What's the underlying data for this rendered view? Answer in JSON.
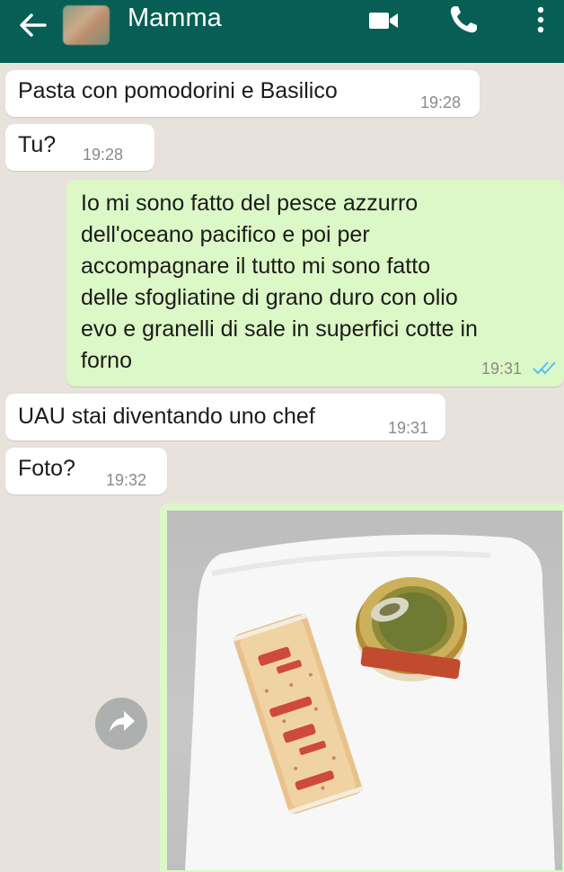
{
  "header": {
    "contact_name": "Mamma",
    "icons": [
      "back-arrow-icon",
      "avatar",
      "video-call-icon",
      "phone-icon",
      "more-options-icon"
    ],
    "bg_color": "#075e54"
  },
  "messages": [
    {
      "direction": "in",
      "text": "Pasta con pomodorini e Basilico",
      "time": "19:28"
    },
    {
      "direction": "in",
      "text": "Tu?",
      "time": "19:28"
    },
    {
      "direction": "out",
      "text": "Io mi sono fatto del pesce azzurro\ndell'oceano pacifico e poi per\naccompagnare il tutto mi sono fatto\ndelle sfogliatine di grano duro con olio\nevo e granelli di sale in superfici cotte in\nforno",
      "time": "19:31",
      "status": "read-double-check-icon"
    },
    {
      "direction": "in",
      "text": "UAU stai diventando uno chef",
      "time": "19:31"
    },
    {
      "direction": "in",
      "text": "Foto?",
      "time": "19:32"
    },
    {
      "direction": "out",
      "type": "image",
      "image_content": "plate with tuna can and cracker pack"
    }
  ],
  "colors": {
    "chat_bg": "#e7e2dc",
    "incoming_bubble": "#ffffff",
    "outgoing_bubble": "#dcf8c6",
    "read_ticks": "#4fc3f7"
  }
}
